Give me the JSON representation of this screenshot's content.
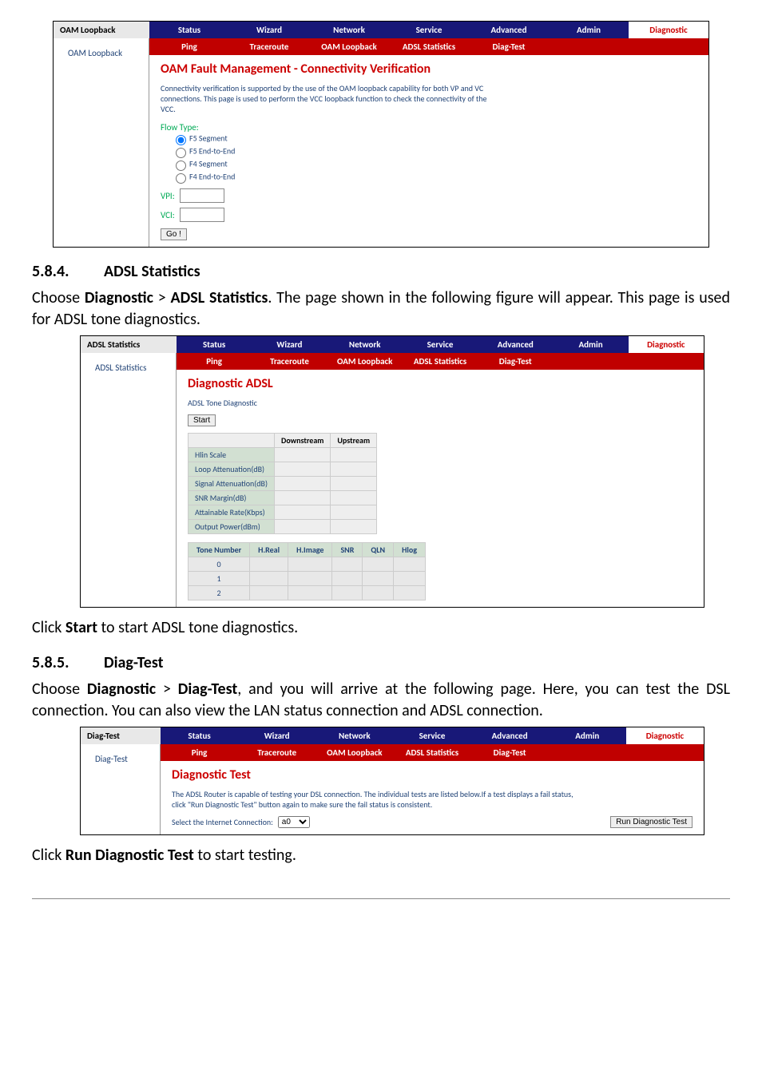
{
  "nav_top": [
    "Status",
    "Wizard",
    "Network",
    "Service",
    "Advanced",
    "Admin",
    "Diagnostic"
  ],
  "sc1": {
    "left_title": "OAM Loopback",
    "left_link": "OAM Loopback",
    "nav_sub": [
      "Ping",
      "Traceroute",
      "OAM Loopback",
      "ADSL Statistics",
      "Diag-Test",
      "",
      ""
    ],
    "heading": "OAM Fault Management - Connectivity Verification",
    "hint": "Connectivity verification is supported by the use of the OAM loopback capability for both VP and VC connections. This page is used to perform the VCC loopback function to check the connectivity of the VCC.",
    "flow_label": "Flow Type:",
    "flow_opts": [
      "F5 Segment",
      "F5 End-to-End",
      "F4 Segment",
      "F4 End-to-End"
    ],
    "vpi_label": "VPI:",
    "vci_label": "VCI:",
    "go": "Go !"
  },
  "sec584": {
    "num": "5.8.4.",
    "title": "ADSL Statistics"
  },
  "p584": "Choose Diagnostic > ADSL Statistics. The page shown in the following figure will appear. This page is used for ADSL tone diagnostics.",
  "sc2": {
    "left_title": "ADSL Statistics",
    "left_link": "ADSL Statistics",
    "nav_sub": [
      "Ping",
      "Traceroute",
      "OAM Loopback",
      "ADSL Statistics",
      "Diag-Test",
      "",
      ""
    ],
    "heading": "Diagnostic ADSL",
    "sublabel": "ADSL Tone Diagnostic",
    "start": "Start",
    "cols": [
      "",
      "Downstream",
      "Upstream"
    ],
    "rows": [
      "Hlin Scale",
      "Loop Attenuation(dB)",
      "Signal Attenuation(dB)",
      "SNR Margin(dB)",
      "Attainable Rate(Kbps)",
      "Output Power(dBm)"
    ],
    "tone_cols": [
      "Tone Number",
      "H.Real",
      "H.Image",
      "SNR",
      "QLN",
      "Hlog"
    ],
    "tone_rows": [
      "0",
      "1",
      "2"
    ]
  },
  "p584b": "Click Start to start ADSL tone diagnostics.",
  "sec585": {
    "num": "5.8.5.",
    "title": "Diag-Test"
  },
  "p585": "Choose Diagnostic > Diag-Test, and you will arrive at the following page. Here, you can test the DSL connection. You can also view the LAN status connection and ADSL connection.",
  "sc3": {
    "left_title": "Diag-Test",
    "left_link": "Diag-Test",
    "nav_sub": [
      "Ping",
      "Traceroute",
      "OAM Loopback",
      "ADSL Statistics",
      "Diag-Test",
      "",
      ""
    ],
    "heading": "Diagnostic Test",
    "hint": "The ADSL Router is capable of testing your DSL connection. The individual tests are listed below.If a test displays a fail status, click \"Run Diagnostic Test\" button again to make sure the fail status is consistent.",
    "select_label": "Select the Internet Connection:",
    "select_value": "a0",
    "run": "Run Diagnostic Test"
  },
  "p585b": "Click Run Diagnostic Test to start testing."
}
